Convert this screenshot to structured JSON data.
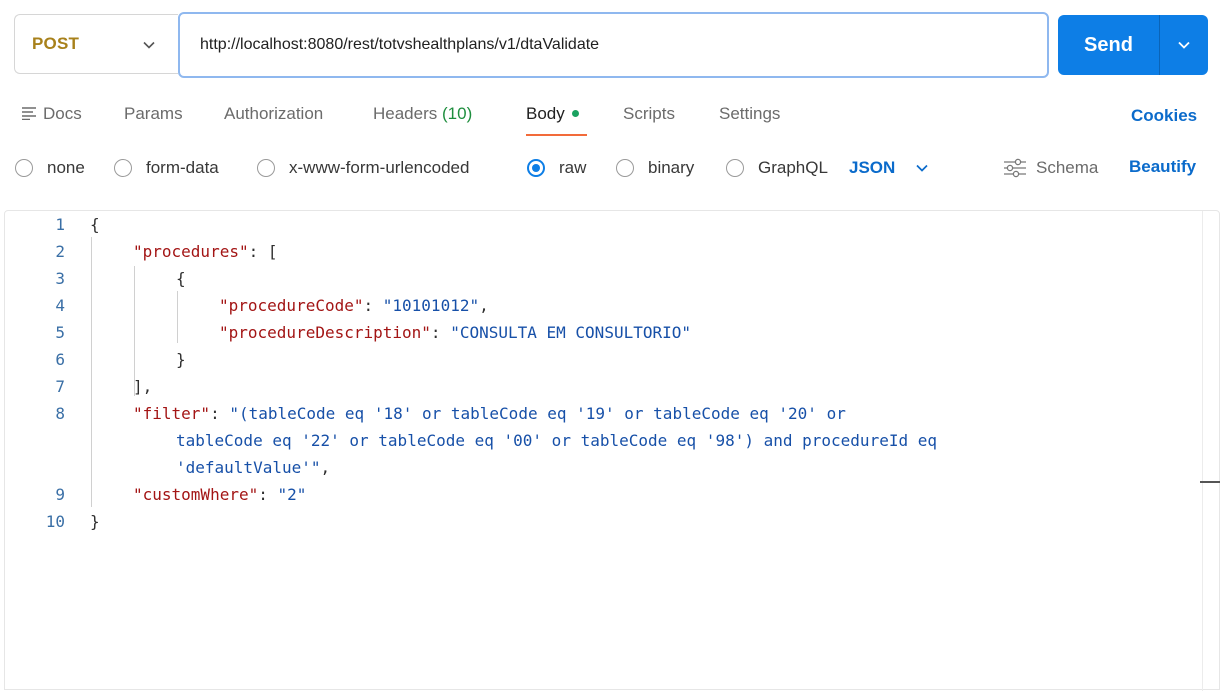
{
  "request": {
    "method": "POST",
    "url": "http://localhost:8080/rest/totvshealthplans/v1/dtaValidate",
    "send_label": "Send"
  },
  "tabs": {
    "docs": "Docs",
    "params": "Params",
    "authorization": "Authorization",
    "headers": "Headers",
    "headers_count": "(10)",
    "body": "Body",
    "scripts": "Scripts",
    "settings": "Settings",
    "active": "Body"
  },
  "cookies_label": "Cookies",
  "body_types": {
    "none": "none",
    "form_data": "form-data",
    "urlencoded": "x-www-form-urlencoded",
    "raw": "raw",
    "binary": "binary",
    "graphql": "GraphQL",
    "selected": "raw"
  },
  "format": "JSON",
  "schema_label": "Schema",
  "beautify_label": "Beautify",
  "editor": {
    "line_numbers": [
      "1",
      "2",
      "3",
      "4",
      "5",
      "6",
      "7",
      "8",
      "9",
      "10"
    ],
    "lines": {
      "l1": "{",
      "l2_key": "\"procedures\"",
      "l2_rest": ": [",
      "l3": "{",
      "l4_key": "\"procedureCode\"",
      "l4_sep": ": ",
      "l4_val": "\"10101012\"",
      "l4_end": ",",
      "l5_key": "\"procedureDescription\"",
      "l5_sep": ": ",
      "l5_val": "\"CONSULTA EM CONSULTORIO\"",
      "l6": "}",
      "l7": "],",
      "l8_key": "\"filter\"",
      "l8_sep": ": ",
      "l8_val_a": "\"(tableCode eq '18' or tableCode eq '19' or tableCode eq '20' or",
      "l8_val_b": "tableCode eq '22' or tableCode eq '00' or tableCode eq '98') and procedureId eq",
      "l8_val_c": "'defaultValue'\"",
      "l8_end": ",",
      "l9_key": "\"customWhere\"",
      "l9_sep": ": ",
      "l9_val": "\"2\"",
      "l10": "}"
    }
  },
  "colors": {
    "method": "#a8811b",
    "send": "#0d7ee6",
    "link": "#0b6bcb",
    "tab_underline": "#f26b3a",
    "json_key": "#a31515",
    "json_string": "#1750a8"
  }
}
